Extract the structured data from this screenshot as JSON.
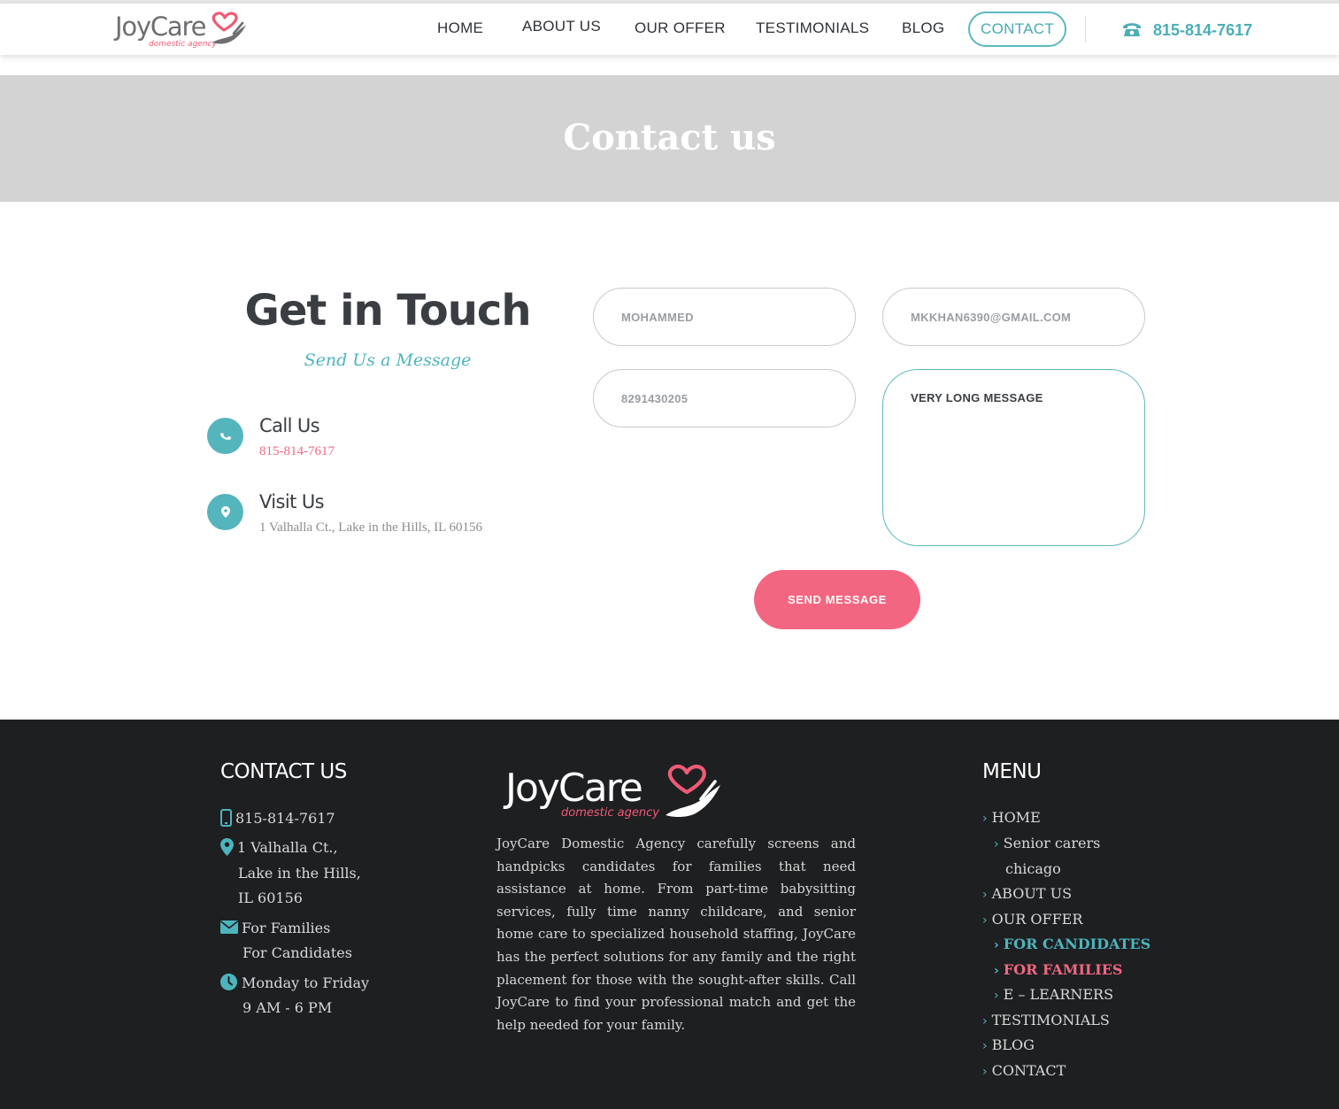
{
  "header": {
    "logo": {
      "word": "JoyCare",
      "tagline": "domestic agency"
    },
    "nav": [
      "HOME",
      "ABOUT US",
      "OUR OFFER",
      "TESTIMONIALS",
      "BLOG"
    ],
    "contact_label": "CONTACT",
    "phone": "815-814-7617"
  },
  "banner": {
    "title": "Contact us"
  },
  "contact": {
    "title": "Get in Touch",
    "subtitle": "Send Us a Message",
    "call": {
      "title": "Call Us",
      "value": "815-814-7617"
    },
    "visit": {
      "title": "Visit Us",
      "value": "1 Valhalla Ct., Lake in the Hills, IL 60156"
    }
  },
  "form": {
    "name_value": "MOHAMMED",
    "email_value": "MKKHAN6390@GMAIL.COM",
    "phone_value": "8291430205",
    "message_value": "VERY LONG MESSAGE",
    "send_label": "SEND MESSAGE"
  },
  "footer": {
    "contact_heading": "CONTACT US",
    "phone": "815-814-7617",
    "address_line1": "1 Valhalla Ct.,",
    "address_line2": "Lake in the Hills,",
    "address_line3": "IL 60156",
    "mail_line1": "For Families",
    "mail_line2": "For Candidates",
    "hours_line1": "Monday to Friday",
    "hours_line2": "9 AM - 6 PM",
    "logo_word": "JoyCare",
    "logo_tagline": "domestic agency",
    "about": "JoyCare Domestic Agency carefully screens and handpicks candidates for families that need assistance at home. From part-time babysitting services, fully time nanny childcare, and senior home care to specialized household staffing, JoyCare has the perfect solutions for any family and the right placement for those with the sought-after skills. Call JoyCare to find your professional match and get the help needed for your family.",
    "menu_heading": "MENU",
    "menu": {
      "home": "HOME",
      "senior_line1": "Senior carers",
      "senior_line2": "chicago",
      "about": "ABOUT US",
      "offer": "OUR OFFER",
      "candidates": "FOR CANDIDATES",
      "families": "FOR FAMILIES",
      "elearners": "E – LEARNERS",
      "testimonials": "TESTIMONIALS",
      "blog": "BLOG",
      "contact": "CONTACT"
    }
  },
  "colors": {
    "teal": "#4db4bd",
    "pink": "#f36681",
    "footer_bg": "#1e1f21",
    "banner_bg": "#d3d3d3"
  }
}
